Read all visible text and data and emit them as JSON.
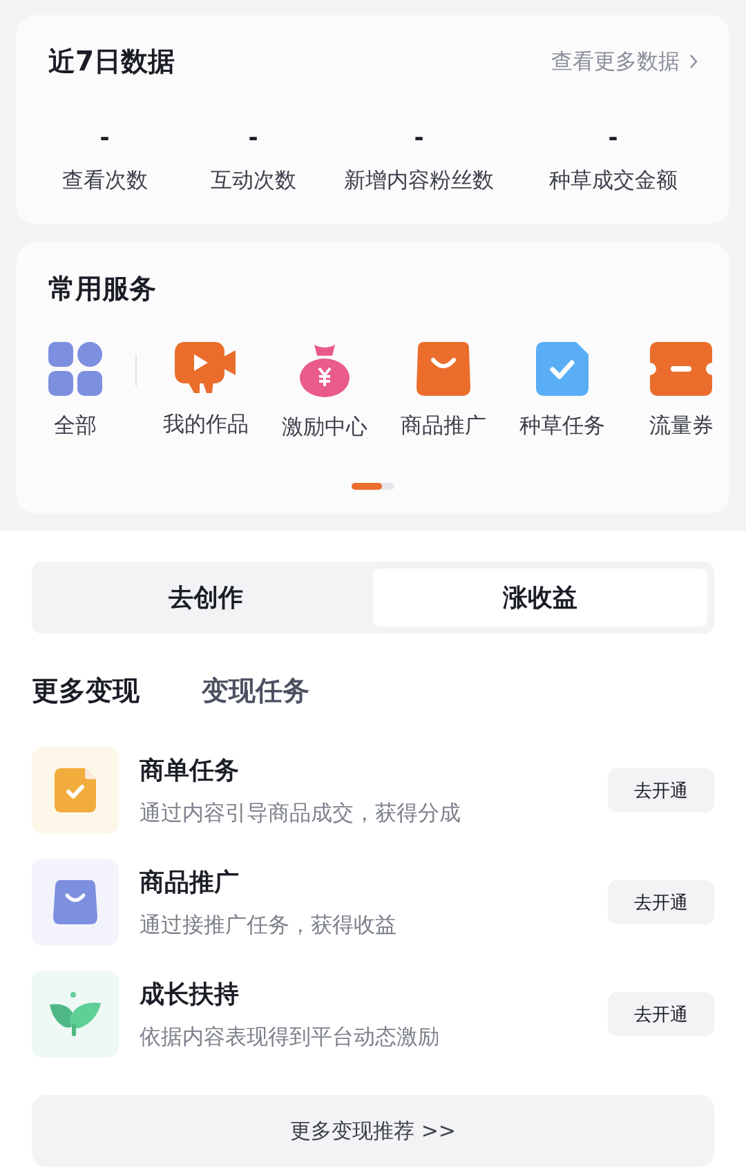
{
  "stats_card": {
    "title": "近7日数据",
    "more_link": "查看更多数据",
    "stats": [
      {
        "value": "-",
        "label": "查看次数"
      },
      {
        "value": "-",
        "label": "互动次数"
      },
      {
        "value": "-",
        "label": "新增内容粉丝数"
      },
      {
        "value": "-",
        "label": "种草成交金额"
      }
    ]
  },
  "services_card": {
    "title": "常用服务",
    "items": [
      {
        "kind": "grid",
        "label": "全部"
      },
      {
        "kind": "video",
        "label": "我的作品"
      },
      {
        "kind": "moneybag",
        "label": "激励中心"
      },
      {
        "kind": "bag",
        "label": "商品推广"
      },
      {
        "kind": "check",
        "label": "种草任务"
      },
      {
        "kind": "ticket",
        "label": "流量券"
      }
    ]
  },
  "segment_tabs": [
    {
      "label": "去创作",
      "selected": false
    },
    {
      "label": "涨收益",
      "selected": true
    }
  ],
  "sub_tabs": [
    {
      "label": "更多变现",
      "selected": true
    },
    {
      "label": "变现任务",
      "selected": false
    }
  ],
  "offers": [
    {
      "kind": "document",
      "title": "商单任务",
      "description": "通过内容引导商品成交，获得分成",
      "action": "去开通"
    },
    {
      "kind": "bag",
      "title": "商品推广",
      "description": "通过接推广任务，获得收益",
      "action": "去开通"
    },
    {
      "kind": "leaf",
      "title": "成长扶持",
      "description": "依据内容表现得到平台动态激励",
      "action": "去开通"
    }
  ],
  "more_button": "更多变现推荐 >>"
}
